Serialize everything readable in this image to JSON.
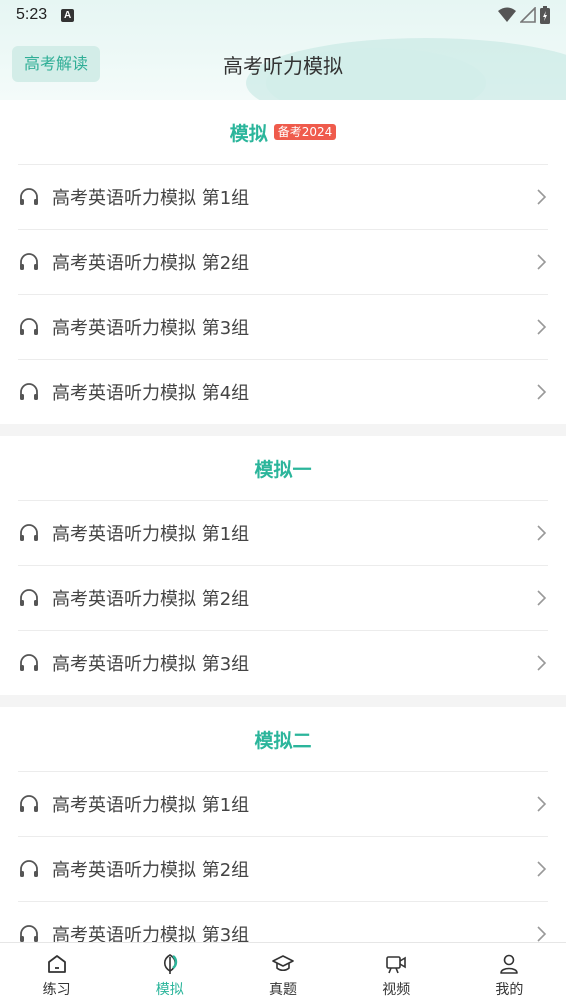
{
  "status": {
    "time": "5:23",
    "a_icon": "A"
  },
  "header": {
    "left_button": "高考解读",
    "title": "高考听力模拟"
  },
  "sections": [
    {
      "title": "模拟",
      "badge": "备考2024",
      "items": [
        "高考英语听力模拟 第1组",
        "高考英语听力模拟 第2组",
        "高考英语听力模拟 第3组",
        "高考英语听力模拟 第4组"
      ]
    },
    {
      "title": "模拟一",
      "items": [
        "高考英语听力模拟 第1组",
        "高考英语听力模拟 第2组",
        "高考英语听力模拟 第3组"
      ]
    },
    {
      "title": "模拟二",
      "items": [
        "高考英语听力模拟 第1组",
        "高考英语听力模拟 第2组",
        "高考英语听力模拟 第3组"
      ]
    }
  ],
  "tabs": [
    {
      "label": "练习",
      "icon": "home-icon"
    },
    {
      "label": "模拟",
      "icon": "leaf-icon",
      "active": true
    },
    {
      "label": "真题",
      "icon": "graduation-cap-icon"
    },
    {
      "label": "视频",
      "icon": "video-icon"
    },
    {
      "label": "我的",
      "icon": "user-icon"
    }
  ],
  "colors": {
    "accent": "#2bb59b",
    "badge": "#ef5b4c",
    "header_bg": "#e6f6f3"
  }
}
